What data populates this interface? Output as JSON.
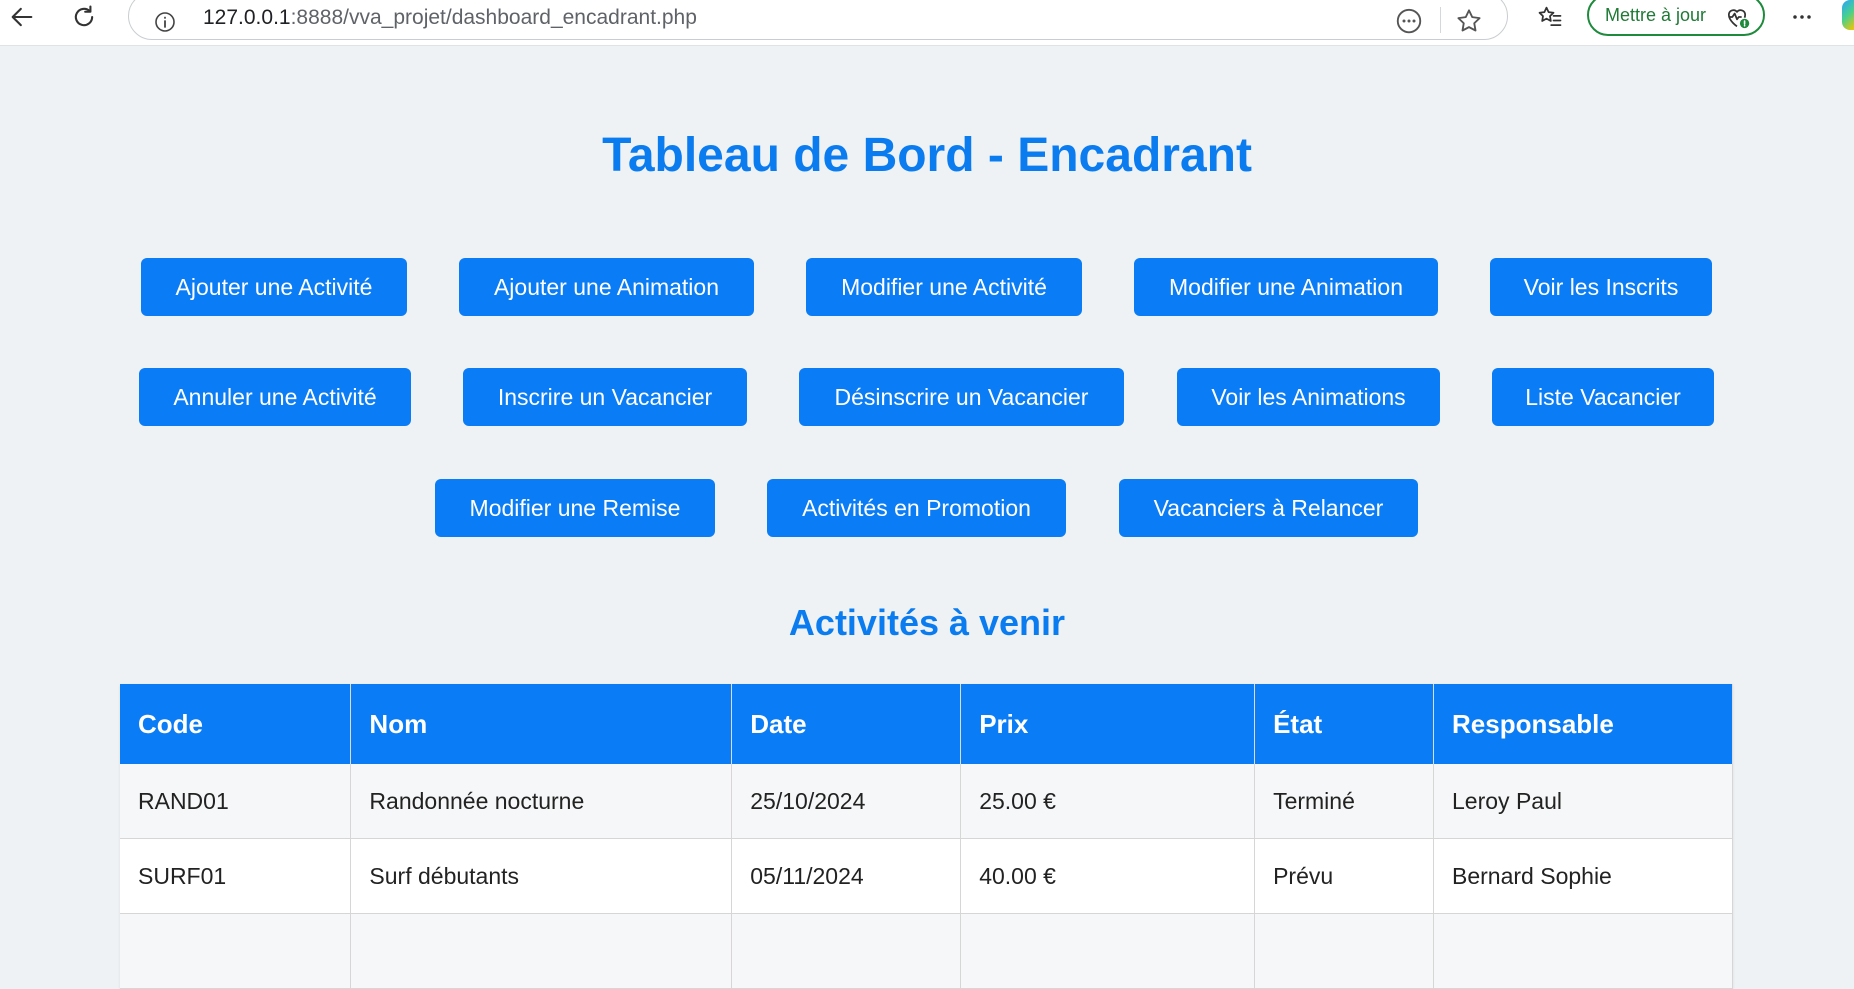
{
  "browser": {
    "url_host": "127.0.0.1",
    "url_rest": ":8888/vva_projet/dashboard_encadrant.php",
    "update_label": "Mettre à jour"
  },
  "page": {
    "title": "Tableau de Bord - Encadrant",
    "section_title": "Activités à venir"
  },
  "buttons": {
    "row1": [
      "Ajouter une Activité",
      "Ajouter une Animation",
      "Modifier une Activité",
      "Modifier une Animation",
      "Voir les Inscrits"
    ],
    "row2": [
      "Annuler une Activité",
      "Inscrire un Vacancier",
      "Désinscrire un Vacancier",
      "Voir les Animations",
      "Liste Vacancier"
    ],
    "row3": [
      "Modifier une Remise",
      "Activités en Promotion",
      "Vacanciers à Relancer"
    ]
  },
  "table": {
    "headers": [
      "Code",
      "Nom",
      "Date",
      "Prix",
      "État",
      "Responsable"
    ],
    "rows": [
      [
        "RAND01",
        "Randonnée nocturne",
        "25/10/2024",
        "25.00 €",
        "Terminé",
        "Leroy Paul"
      ],
      [
        "SURF01",
        "Surf débutants",
        "05/11/2024",
        "40.00 €",
        "Prévu",
        "Bernard Sophie"
      ],
      [
        "",
        "",
        "",
        "",
        "",
        ""
      ]
    ]
  },
  "colors": {
    "primary": "#0a7cf5",
    "title": "#0b7cf0",
    "background": "#eef2f4"
  }
}
